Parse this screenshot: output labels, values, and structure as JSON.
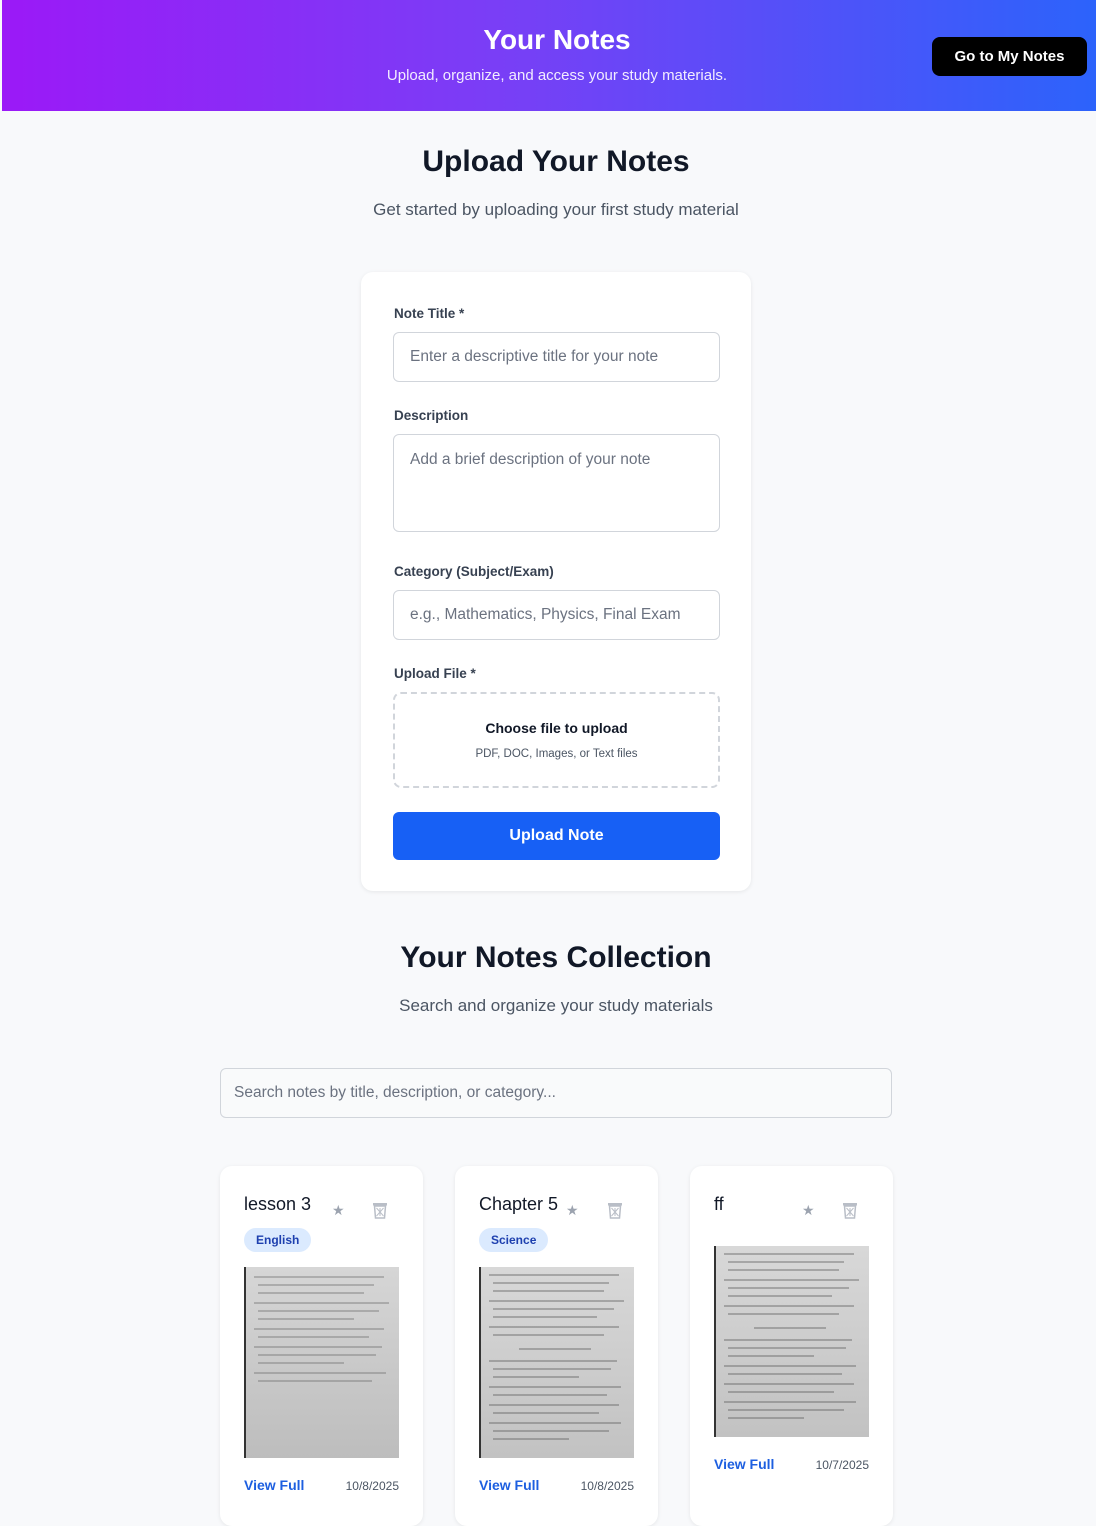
{
  "header": {
    "title": "Your Notes",
    "subtitle": "Upload, organize, and access your study materials.",
    "my_notes_button": "Go to My Notes"
  },
  "upload": {
    "title": "Upload Your Notes",
    "subtitle": "Get started by uploading your first study material",
    "note_title_label": "Note Title *",
    "note_title_placeholder": "Enter a descriptive title for your note",
    "description_label": "Description",
    "description_placeholder": "Add a brief description of your note",
    "category_label": "Category (Subject/Exam)",
    "category_placeholder": "e.g., Mathematics, Physics, Final Exam",
    "file_label": "Upload File *",
    "file_choose": "Choose file to upload",
    "file_types": "PDF, DOC, Images, or Text files",
    "submit_button": "Upload Note"
  },
  "collection": {
    "title": "Your Notes Collection",
    "subtitle": "Search and organize your study materials",
    "search_placeholder": "Search notes by title, description, or category..."
  },
  "notes": [
    {
      "title": "lesson 3",
      "category": "English",
      "view_label": "View Full",
      "date": "10/8/2025",
      "star_icon": "star-icon",
      "trash_icon": "trash-icon"
    },
    {
      "title": "Chapter 5",
      "category": "Science",
      "view_label": "View Full",
      "date": "10/8/2025",
      "star_icon": "star-icon",
      "trash_icon": "trash-icon"
    },
    {
      "title": "ff",
      "category": "",
      "view_label": "View Full",
      "date": "10/7/2025",
      "star_icon": "star-icon",
      "trash_icon": "trash-icon"
    }
  ],
  "colors": {
    "header_gradient_start": "#9b19f7",
    "header_gradient_end": "#2c63fb",
    "primary_button": "#1760f5",
    "badge_bg": "#dbeafe",
    "badge_text": "#1e40af",
    "link": "#1d5fe0"
  }
}
